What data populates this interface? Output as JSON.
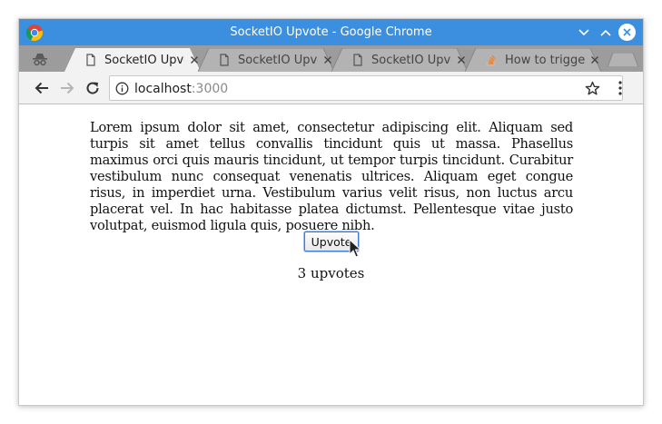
{
  "window": {
    "title": "SocketIO Upvote - Google Chrome"
  },
  "tabs": [
    {
      "label": "SocketIO Upvote",
      "icon": "page-icon",
      "active": true
    },
    {
      "label": "SocketIO Upvote",
      "icon": "page-icon",
      "active": false
    },
    {
      "label": "SocketIO Upvote",
      "icon": "page-icon",
      "active": false
    },
    {
      "label": "How to trigger",
      "icon": "stackoverflow-icon",
      "active": false
    }
  ],
  "toolbar": {
    "url_host": "localhost",
    "url_port": ":3000"
  },
  "page": {
    "paragraph": "Lorem ipsum dolor sit amet, consectetur adipiscing elit. Aliquam sed turpis sit amet tellus convallis tincidunt quis ut massa. Phasellus maximus orci quis mauris tincidunt, ut tempor turpis tincidunt. Curabitur vestibulum nunc consequat venenatis ultrices. Aliquam eget congue risus, in imperdiet urna. Vestibulum varius velit risus, non luctus arcu placerat vel. In hac habitasse platea dictumst. Pellentesque vitae justo volutpat, euismod ligula quis, posuere nibh.",
    "upvote_button": "Upvote",
    "upvote_count": "3 upvotes"
  },
  "colors": {
    "titlebar": "#3c8fde",
    "tabstrip": "#9c9c9c",
    "toolbar": "#f2f2f2"
  }
}
